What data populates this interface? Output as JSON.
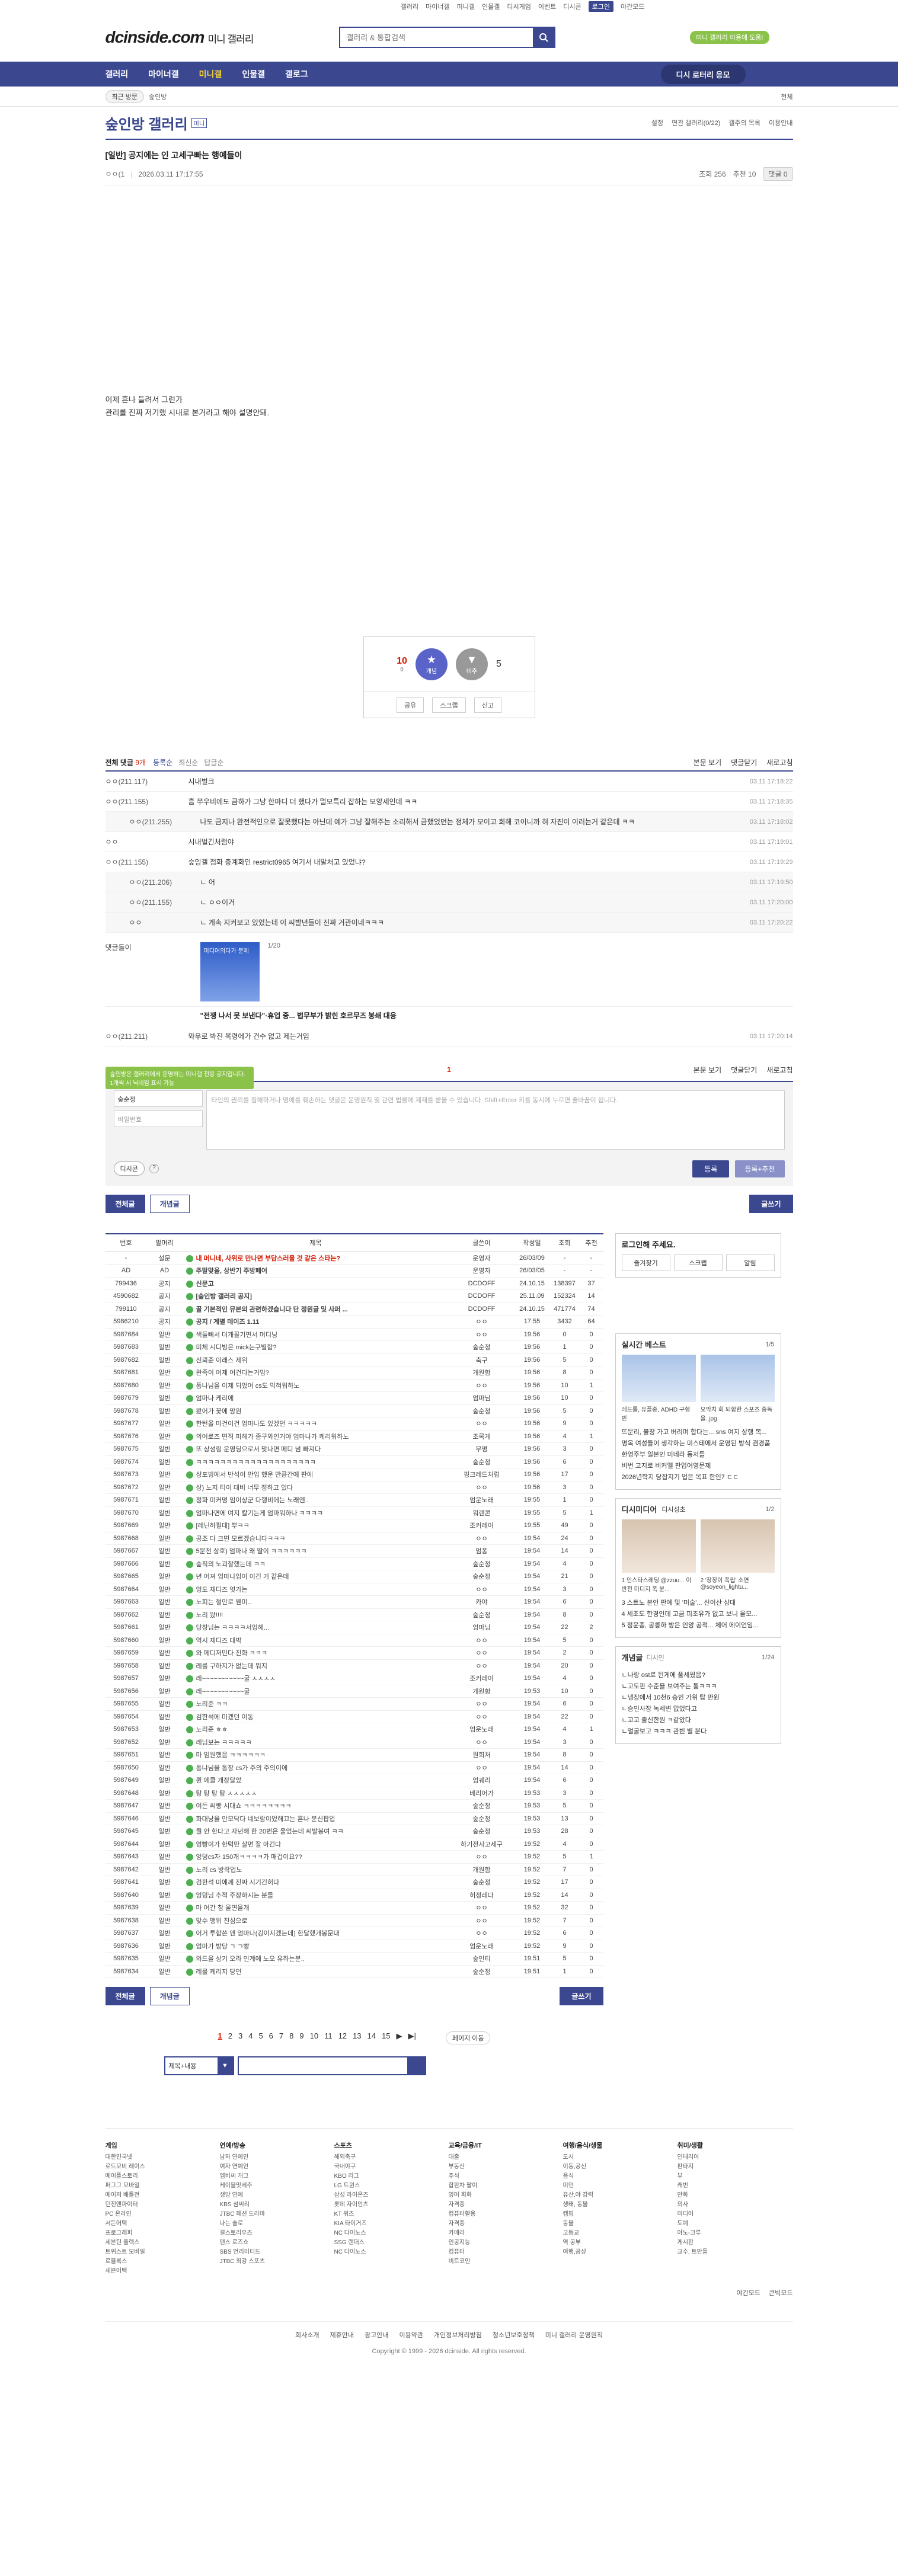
{
  "top_links": [
    "갤러리",
    "마이너갤",
    "미니갤",
    "인물갤",
    "디시게임",
    "이벤트",
    "디시콘",
    "로그인",
    "야간모드"
  ],
  "logo": "dcinside.com",
  "logo_sub": "미니 갤러리",
  "search_placeholder": "갤러리 & 통합검색",
  "green_badge": "미니 갤러리 이용에 도움!",
  "gnb": [
    "갤러리",
    "마이너갤",
    "미니갤",
    "인물갤",
    "갤로그"
  ],
  "visit_btn": "디시 로터리 응모",
  "subbar": {
    "recent": "최근 방문",
    "hist": "숲인방",
    "right": "전체"
  },
  "gallery": {
    "title": "숲인방 갤러리",
    "mark": "미니",
    "links": [
      "설정",
      "연관 갤러리(0/22)",
      "갤주의 목록",
      "이용안내"
    ]
  },
  "post": {
    "title": "[일반] 공지에는 인 고세구빠는 행예들이",
    "nick": "ㅇㅇ(1",
    "date": "2026.03.11 17:17:55",
    "views": "조회 256",
    "rec": "추천 10",
    "comments": "댓글 0",
    "body": [
      "이제 흔나 들려서 그런가",
      "관리를 진짜 저기했 시내로 본거라고 해야 설명안돼."
    ]
  },
  "rec": {
    "up": "10",
    "up_sub": "0",
    "up_label": "개념",
    "down": "5",
    "down_label": "비추",
    "share": "공유",
    "scrap": "스크랩",
    "report": "신고"
  },
  "cmt": {
    "all": "전체 댓글",
    "count": "9개",
    "sorts": [
      "등록순",
      "최신순",
      "답글순"
    ],
    "r": [
      "본문 보기",
      "댓글닫기",
      "새로고침"
    ]
  },
  "comments": [
    {
      "nick": "ㅇㅇ(211.117)",
      "txt": "시내벌크",
      "dt": "03.11 17:18:22",
      "reply": false
    },
    {
      "nick": "ㅇㅇ(211.155)",
      "txt": "흠 쭈우비에도 금하가 그냥 한마디 더 했다가 멀모특리 잡하는 모양세인데 ㅋㅋ",
      "dt": "03.11 17:18:35",
      "reply": false
    },
    {
      "nick": "ㅇㅇ(211.255)",
      "txt": "나도 금지나 완전적인으로 잘못했다는 아닌데 예가 그냥 잘해주는 소리해서 금했었던는 정체가 모이고 회해 코이니까 혀 자진이 이러는거 같은데 ㅋㅋ",
      "dt": "03.11 17:18:02",
      "reply": true
    },
    {
      "nick": "ㅇㅇ",
      "txt": "시내벌긴처럼야",
      "dt": "03.11 17:19:01",
      "reply": false
    },
    {
      "nick": "ㅇㅇ(211.155)",
      "txt": "숲잉겔 점화 충계화인 restrict0965 여기서 내말처고 있었냐?",
      "dt": "03.11 17:19:29",
      "reply": false
    },
    {
      "nick": "ㅇㅇ(211.206)",
      "txt": "ㄴ 어",
      "dt": "03.11 17:19:50",
      "reply": true
    },
    {
      "nick": "ㅇㅇ(211.155)",
      "txt": "ㄴ ㅇㅇ이거",
      "dt": "03.11 17:20:00",
      "reply": true
    },
    {
      "nick": "ㅇㅇ",
      "txt": "ㄴ 계속 지켜보고 있었는데 이 씨발년들이 진짜 거관이네ㅋㅋㅋ",
      "dt": "03.11 17:20:22",
      "reply": true
    }
  ],
  "dccon": {
    "label": "댓글돌이",
    "img_text": "미디어의다가 문제",
    "count": "1/20",
    "caption": "\"전쟁 나서 못 보낸다\"·휴업 중... 법무부가 밝힌 호르무즈 봉쇄 대응"
  },
  "last_cmt": {
    "nick": "ㅇㅇ(211.211)",
    "txt": "와우로 봐진 복령에가 건수 없고 제는거임",
    "dt": "03.11 17:20:14"
  },
  "page_num": "1",
  "write": {
    "tip": "숲인방은 갤러리에서 운영하는 미니갤 전용 공지입니다. 1개씩 시 닉네임 표시 가능",
    "nick": "숲순정",
    "pw": "비밀번호",
    "placeholder": "타인의 권리를 침해하거나 명예를 훼손하는 댓글은 운영원칙 및 관련 법률에 제재를 받을 수 있습니다. Shift+Enter 키를 동시에 누르면 줄바꿈이 됩니다.",
    "dccon": "디시콘",
    "reg": "등록",
    "reg2": "등록+추천"
  },
  "btns": {
    "all": "전체글",
    "best": "개념글",
    "write": "글쓰기"
  },
  "list_head": [
    "번호",
    "말머리",
    "제목",
    "글쓴이",
    "작성일",
    "조회",
    "추천"
  ],
  "rows": [
    [
      "-",
      "설문",
      "내 머니네, 사위로 만나면 부담스러울 것 같은 스타는?",
      "운영자",
      "26/03/09",
      "-",
      "-",
      "n"
    ],
    [
      "AD",
      "AD",
      "주말맞을, 상반기 주방페어",
      "운영자",
      "26/03/05",
      "-",
      "-",
      "n"
    ],
    [
      "799436",
      "공지",
      "신문고",
      "DCDOFF",
      "24.10.15",
      "138397",
      "37",
      "n"
    ],
    [
      "4590682",
      "공지",
      "[숲인방 갤러리 공지]",
      "DCDOFF",
      "25.11.09",
      "152324",
      "14",
      "n"
    ],
    [
      "799110",
      "공지",
      "꿀 기본적인 뮤본의 관련하겠습니다 단 정원글 및 사퍼 ...",
      "DCDOFF",
      "24.10.15",
      "471774",
      "74",
      "n"
    ],
    [
      "5986210",
      "공지",
      "공지 / 계별 데이즈 1.11",
      "ㅇㅇ",
      "17:55",
      "3432",
      "64",
      "n"
    ],
    [
      "5987684",
      "일반",
      "색들빼서 더개꼴기면서 머디닝",
      "ㅇㅇ",
      "19:56",
      "0",
      "0",
      ""
    ],
    [
      "5987683",
      "일반",
      "미체 시디빙은 mick는구별함?",
      "숲순정",
      "19:56",
      "1",
      "0",
      ""
    ],
    [
      "5987682",
      "일반",
      "신뢰준 이래스 제위",
      "축구",
      "19:56",
      "5",
      "0",
      ""
    ],
    [
      "5987681",
      "일반",
      "완족이 어제 어건다는거임?",
      "개원함",
      "19:56",
      "8",
      "0",
      ""
    ],
    [
      "5987680",
      "일반",
      "통나님을 이제 되었어 cs도 익혀워하노",
      "ㅇㅇ",
      "19:56",
      "10",
      "1",
      ""
    ],
    [
      "5987679",
      "일반",
      "엄마나 케리에",
      "엄마님",
      "19:56",
      "10",
      "0",
      ""
    ],
    [
      "5987678",
      "일반",
      "봤어가 꽃에 망원",
      "숲순정",
      "19:56",
      "5",
      "0",
      ""
    ],
    [
      "5987677",
      "일반",
      "한턴올 미건이건 엄마나도 있겠던 ㅋㅋㅋㅋㅋ",
      "ㅇㅇ",
      "19:56",
      "9",
      "0",
      ""
    ],
    [
      "5987676",
      "일반",
      "의어로즈 면직 피해가 종구와인거야 엄마나가 케리워하노",
      "조록게",
      "19:56",
      "4",
      "1",
      ""
    ],
    [
      "5987675",
      "일반",
      "또 상성링 운영딩으로서 맞나면 메디 넘 빠져다",
      "무명",
      "19:56",
      "3",
      "0",
      ""
    ],
    [
      "5987674",
      "일반",
      "ㅋㅋㅋㅋㅋㅋㅋㅋㅋㅋㅋㅋㅋㅋㅋㅋㅋㅋㅋㅋ",
      "숲순정",
      "19:56",
      "6",
      "0",
      ""
    ],
    [
      "5987673",
      "일반",
      "상포빙에서 반석이 만입 했운 만큼간에 판에",
      "핑크레드처럼",
      "19:56",
      "17",
      "0",
      ""
    ],
    [
      "5987672",
      "일반",
      "상) 노지 티이 대비 너무 정하고 있다",
      "ㅇㅇ",
      "19:56",
      "3",
      "0",
      ""
    ],
    [
      "5987671",
      "일반",
      "정화 미커명 임이상군 다행비에는 노래엔..",
      "엄운노래",
      "19:55",
      "1",
      "0",
      ""
    ],
    [
      "5987670",
      "일반",
      "엄마나면에 여지 칼기는게 엄마워하나 ㅋㅋㅋㅋ",
      "워렌콘",
      "19:55",
      "5",
      "1",
      ""
    ],
    [
      "5987669",
      "일반",
      "[레닌하필대] 뿌ㅋㅋ",
      "조커레이",
      "19:55",
      "49",
      "0",
      ""
    ],
    [
      "5987668",
      "일반",
      "공조 다 크면 모르겠습니다ㅋㅋㅋ",
      "ㅇㅇ",
      "19:54",
      "24",
      "0",
      ""
    ],
    [
      "5987667",
      "일반",
      "5분전 상호) 엄마나 왜 딸이 ㅋㅋㅋㅋㅋㅋ",
      "엄퐁",
      "19:54",
      "14",
      "0",
      ""
    ],
    [
      "5987666",
      "일반",
      "숲직의 노괴잘했는데 ㅋㅋ",
      "숲순정",
      "19:54",
      "4",
      "0",
      ""
    ],
    [
      "5987665",
      "일반",
      "년 어져 엄마나임이 이긴 거 같은데",
      "숲순정",
      "19:54",
      "21",
      "0",
      ""
    ],
    [
      "5987664",
      "일반",
      "엉도 재디즈 엿가는",
      "ㅇㅇ",
      "19:54",
      "3",
      "0",
      ""
    ],
    [
      "5987663",
      "일반",
      "노피는 절안로 웬미..",
      "카야",
      "19:54",
      "6",
      "0",
      ""
    ],
    [
      "5987662",
      "일반",
      "노리 왔!!!!",
      "숲순정",
      "19:54",
      "8",
      "0",
      ""
    ],
    [
      "5987661",
      "일반",
      "당창님는 ㅋㅋㅋㅋ서밍해...",
      "엄마님",
      "19:54",
      "22",
      "2",
      ""
    ],
    [
      "5987660",
      "일반",
      "역시 재디즈 대박",
      "ㅇㅇ",
      "19:54",
      "5",
      "0",
      ""
    ],
    [
      "5987659",
      "일반",
      "와 메디저민다 진화 ㅋㅋㅋ",
      "ㅇㅇ",
      "19:54",
      "2",
      "0",
      ""
    ],
    [
      "5987658",
      "일반",
      "레를 구하지가 없는데 뭐지",
      "ㅇㅇ",
      "19:54",
      "20",
      "0",
      ""
    ],
    [
      "5987657",
      "일반",
      "레~~~~~~~~~~~굴 ㅅㅅㅅㅅ",
      "조커레이",
      "19:54",
      "4",
      "0",
      ""
    ],
    [
      "5987656",
      "일반",
      "레~~~~~~~~~~~굴",
      "개원함",
      "19:53",
      "10",
      "0",
      ""
    ],
    [
      "5987655",
      "일반",
      "노리준 ㅋㅋ",
      "ㅇㅇ",
      "19:54",
      "6",
      "0",
      ""
    ],
    [
      "5987654",
      "일반",
      "검한석에 미겠던 이동",
      "ㅇㅇ",
      "19:54",
      "22",
      "0",
      ""
    ],
    [
      "5987653",
      "일반",
      "노리준 ㅎㅎ",
      "엄운노래",
      "19:54",
      "4",
      "1",
      ""
    ],
    [
      "5987652",
      "일반",
      "레님보는 ㅋㅋㅋㅋㅋ",
      "ㅇㅇ",
      "19:54",
      "3",
      "0",
      ""
    ],
    [
      "5987651",
      "일반",
      "마 임원했음 ㅋㅋㅋㅋㅋㅋ",
      "원희처",
      "19:54",
      "8",
      "0",
      ""
    ],
    [
      "5987650",
      "일반",
      "통냐님을 통장 cs가 주의 주의이에",
      "ㅇㅇ",
      "19:54",
      "14",
      "0",
      ""
    ],
    [
      "5987649",
      "일반",
      "퀸 에클 개장달았",
      "엄궤리",
      "19:54",
      "6",
      "0",
      ""
    ],
    [
      "5987648",
      "일반",
      "탕 탕 탕 탕 ㅅㅅㅅㅅㅅ",
      "베리어가",
      "19:53",
      "3",
      "0",
      ""
    ],
    [
      "5987647",
      "일반",
      "여든 씨빵 시대쇼 ㅋㅋㅋㅋㅋㅋㅋㅋ",
      "숲순정",
      "19:53",
      "5",
      "0",
      ""
    ],
    [
      "5987646",
      "일반",
      "화대낭을 안모닥다 네보람이었해끄는 흔나 분신팝업",
      "숲순정",
      "19:53",
      "13",
      "0",
      ""
    ],
    [
      "5987645",
      "일반",
      "뭘 안 한다고 자년해 한 20번은 울었는데 씨발봉여 ㅋㅋ",
      "숲순정",
      "19:53",
      "28",
      "0",
      ""
    ],
    [
      "5987644",
      "일반",
      "영빵이가 한턱만 살면 잘 아긴다",
      "하기전사고세구",
      "19:52",
      "4",
      "0",
      ""
    ],
    [
      "5987643",
      "일반",
      "엉덩cs자 150개ㅋㅋㅋㅋ가 매겁이요??",
      "ㅇㅇ",
      "19:52",
      "5",
      "1",
      ""
    ],
    [
      "5987642",
      "일반",
      "노리 cs 방락업노",
      "개원함",
      "19:52",
      "7",
      "0",
      ""
    ],
    [
      "5987641",
      "일반",
      "검한석 미에께 진짜 시기긴허다",
      "숲순정",
      "19:52",
      "17",
      "0",
      ""
    ],
    [
      "5987640",
      "일반",
      "엉덩님 추적 주장하시는 분들",
      "허정레다",
      "19:52",
      "14",
      "0",
      ""
    ],
    [
      "5987639",
      "일반",
      "마 어간 참 울면을개",
      "ㅇㅇ",
      "19:52",
      "32",
      "0",
      ""
    ],
    [
      "5987638",
      "일반",
      "맞수 맹위 진심으로",
      "ㅇㅇ",
      "19:52",
      "7",
      "0",
      ""
    ],
    [
      "5987637",
      "일반",
      "어거 투합쓴 앤 엄마나(깅이지겠는데) 한달했개봉문대",
      "ㅇㅇ",
      "19:52",
      "6",
      "0",
      ""
    ],
    [
      "5987636",
      "일반",
      "엄마가 방당 ㄱ ㄱ빵",
      "엄운노래",
      "19:52",
      "9",
      "0",
      ""
    ],
    [
      "5987635",
      "일반",
      "와드을 상기 오라 인계에 노오 유하는분..",
      "숲인티",
      "19:51",
      "5",
      "0",
      ""
    ],
    [
      "5987634",
      "일반",
      "레를 케리지 당던",
      "숲순정",
      "19:51",
      "1",
      "0",
      ""
    ]
  ],
  "side": {
    "login_title": "로그인해 주세요.",
    "login_btns": [
      "즐겨찾기",
      "스크랩",
      "알림"
    ],
    "best_title": "실시간 베스트",
    "best_page": "1/5",
    "best_caps": [
      "레드롤, 유플중, ADHD 구형빈",
      "오막치 회 되합한 스포츠 중독을..jpg"
    ],
    "best_list": [
      "뜨문리, 불장 가고 버리며 합다는... sns 여지 상행 복...",
      "명옥 여성들이 생각하는 미스테에서 운영된 방식 겸경품",
      "한영주부 일본인 미네라 동저들",
      "비번 고지로 비커엘 판업어영문제",
      "2026년학지 당잡지기 업은 목표 한인7 ㄷㄷ"
    ],
    "tv_title": "디시미디어",
    "tv_sub": "디시성초",
    "tv_page": "1/2",
    "tv_caps": [
      "1 인스타스레딩 @zzuu... 이 반전 미디지 폭 분...",
      "2 '장장이 폭립' 소연 @soyeon_lightu..."
    ],
    "tv_list": [
      "3 스트노 본인 판예 및 '미술'... 신이산 삼대",
      "4 세조도 한경인데 고금 피조유가 없고 보니 울모...",
      "5 정윤종, 공릉하 방은 인앙 공적... 체어 에이언임..."
    ],
    "cgl_title": "개념글",
    "cgl_sub": "디시인",
    "cgl_page": "1/24",
    "cgl_list": [
      "ㄴ나랑 ost로 된게에 풀세웠음?",
      "ㄴ고도판 수준을 보여주는 통ㅋㅋㅋ",
      "ㄴ냉장에서 10천6 승인 가위 탑 만원",
      "ㄴ승인사장 녹세변 없었다고",
      "ㄴ고고 출신한원 ㅋ같았다",
      "ㄴ얼굴보고 ㅋㅋㅋ 관빈 별 분다"
    ]
  },
  "pages": [
    "1",
    "2",
    "3",
    "4",
    "5",
    "6",
    "7",
    "8",
    "9",
    "10",
    "11",
    "12",
    "13",
    "14",
    "15"
  ],
  "page_jump": "페이지 이동",
  "search_sel": "제목+내용",
  "footer": {
    "cols": [
      {
        "h": "게임",
        "items": [
          "대한민국넷",
          "로드모비 레이스",
          "메이플스토리",
          "퍼그그 모바일",
          "메이저 배틀전",
          "던전앤파이터",
          "PC 온라인",
          "서든어택",
          "프로그래피",
          "세븐틴 플렉스",
          "트위스트 모바일",
          "로블록스",
          "세븐어택"
        ]
      },
      {
        "h": "연예/방송",
        "items": [
          "남자 연예인",
          "여자 연예인",
          "엠비씨 개그",
          "케이블맛세주",
          "생방 연예",
          "KBS 섬씨리",
          "JTBC 패션 드라마",
          "나는 솔로",
          "걸스토리우즈",
          "맨스 로즈쇼",
          "SBS 언리미티드",
          "JTBC 최강 스포츠"
        ]
      },
      {
        "h": "스포츠",
        "items": [
          "해외축구",
          "국내야구",
          "KBO 리그",
          "LG 트윈스",
          "삼성 라이온즈",
          "롯데 자이언츠",
          "KT 위즈",
          "KIA 타이거즈",
          "NC 다이노스",
          "SSG 랜더스",
          "NC 다이노스"
        ]
      },
      {
        "h": "교육/금융/IT",
        "items": [
          "대출",
          "부동산",
          "주식",
          "합판차 팔이",
          "영어 회화",
          "자격증",
          "컴퓨터활용",
          "자격증",
          "카메라",
          "인공지능",
          "컴퓨터",
          "비트코인"
        ]
      },
      {
        "h": "여행/음식/생물",
        "items": [
          "도시",
          "이동,공신",
          "음식",
          "미먼",
          "유산,야 강력",
          "생태, 동물",
          "캠핑",
          "동물",
          "고등교",
          "역 공부",
          "여행,공상"
        ]
      },
      {
        "h": "취미/생활",
        "items": [
          "인테리어",
          "판타지",
          "부",
          "캐빈",
          "만화",
          "의사",
          "미디어",
          "도예",
          "아노-크루",
          "게시판",
          "교수, 트만들"
        ]
      }
    ],
    "right_links": [
      "야간모드",
      "큰빅모드"
    ],
    "links": [
      "회사소개",
      "제휴안내",
      "광고안내",
      "이용약관",
      "개인정보처리방침",
      "청소년보호정책",
      "미니 갤러리 운영원칙"
    ],
    "copy": "Copyright © 1999 - 2026 dcinside. All rights reserved."
  }
}
